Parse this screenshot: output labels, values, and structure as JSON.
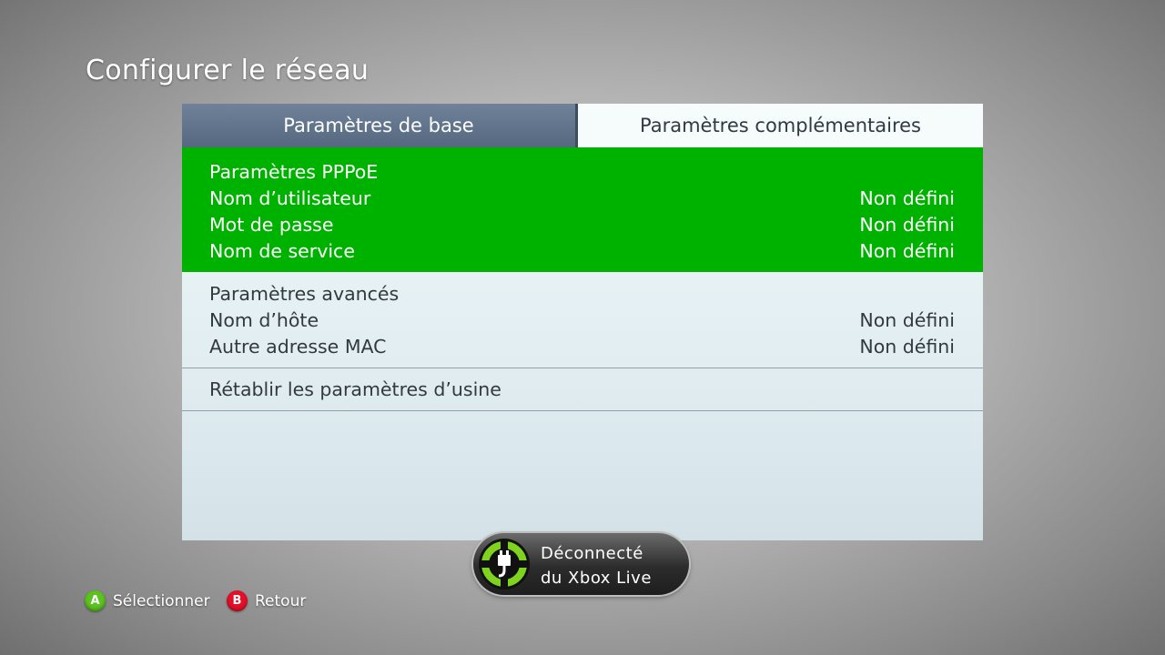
{
  "page": {
    "title": "Configurer le réseau"
  },
  "tabs": [
    {
      "label": "Paramètres de base",
      "selected": false
    },
    {
      "label": "Paramètres complémentaires",
      "selected": true
    }
  ],
  "pppoe": {
    "header": "Paramètres PPPoE",
    "rows": [
      {
        "label": "Nom d’utilisateur",
        "value": "Non défini"
      },
      {
        "label": "Mot de passe",
        "value": "Non défini"
      },
      {
        "label": "Nom de service",
        "value": "Non défini"
      }
    ]
  },
  "advanced": {
    "header": "Paramètres avancés",
    "rows": [
      {
        "label": "Nom d’hôte",
        "value": "Non défini"
      },
      {
        "label": "Autre adresse MAC",
        "value": "Non défini"
      }
    ]
  },
  "reset": {
    "label": "Rétablir les paramètres d’usine"
  },
  "status": {
    "line1": "Déconnecté",
    "line2": "du Xbox Live",
    "icon": "network-disconnected-icon"
  },
  "footer": {
    "a_button": {
      "glyph": "A",
      "label": "Sélectionner",
      "color": "#5cc21e"
    },
    "b_button": {
      "glyph": "B",
      "label": "Retour",
      "color": "#e3102a"
    }
  },
  "colors": {
    "selection": "#00b200",
    "tab_inactive": "#5f7289",
    "panel": "#eef8f9"
  }
}
